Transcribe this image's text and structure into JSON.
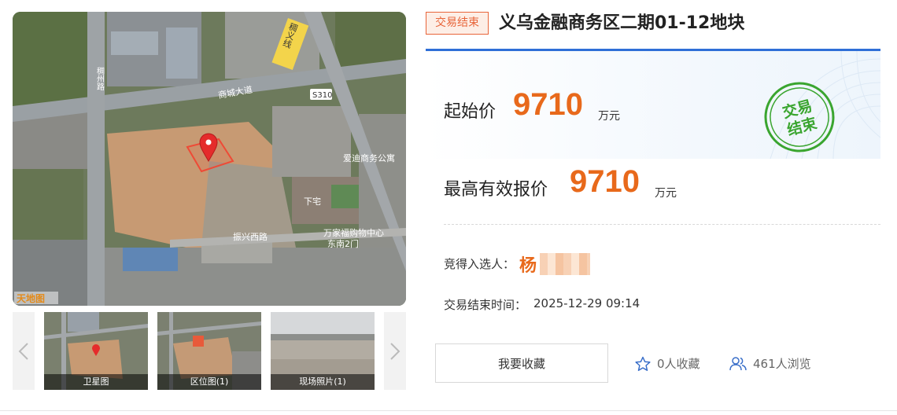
{
  "gallery": {
    "main_photo": {
      "map_labels": {
        "road_shangcheng": "商城大道",
        "road_s310": "S310",
        "road_chouyi": "稠义线",
        "road_left": "稠州路",
        "road_zhenxing": "振兴西路",
        "place_aidi": "爱迪商务公寓",
        "place_xiazhai": "下宅",
        "place_mall": "万家福购物中心",
        "place_mall2": "东南2门",
        "watermark": "天地图"
      }
    },
    "thumbnails": [
      {
        "caption": "卫星图"
      },
      {
        "caption": "区位图(1)"
      },
      {
        "caption": "现场照片(1)"
      }
    ]
  },
  "status_tag": "交易结束",
  "title": "义乌金融商务区二期01-12地块",
  "price": {
    "start_label": "起始价",
    "start_value": "9710",
    "start_unit": "万元",
    "highest_label": "最高有效报价",
    "highest_value": "9710",
    "highest_unit": "万元"
  },
  "stamp": {
    "line1": "交易",
    "line2": "结束"
  },
  "winner": {
    "label": "竞得入选人：",
    "name": "杨"
  },
  "end_time": {
    "label": "交易结束时间：",
    "value": "2025-12-29 09:14"
  },
  "actions": {
    "favorite_button": "我要收藏",
    "favorite_count": "0人收藏",
    "view_count": "461人浏览"
  },
  "colors": {
    "accent_orange": "#e8691b",
    "tag_orange": "#e8653a",
    "blue_line": "#2f6fd7",
    "stamp_green": "#3aa52f"
  }
}
